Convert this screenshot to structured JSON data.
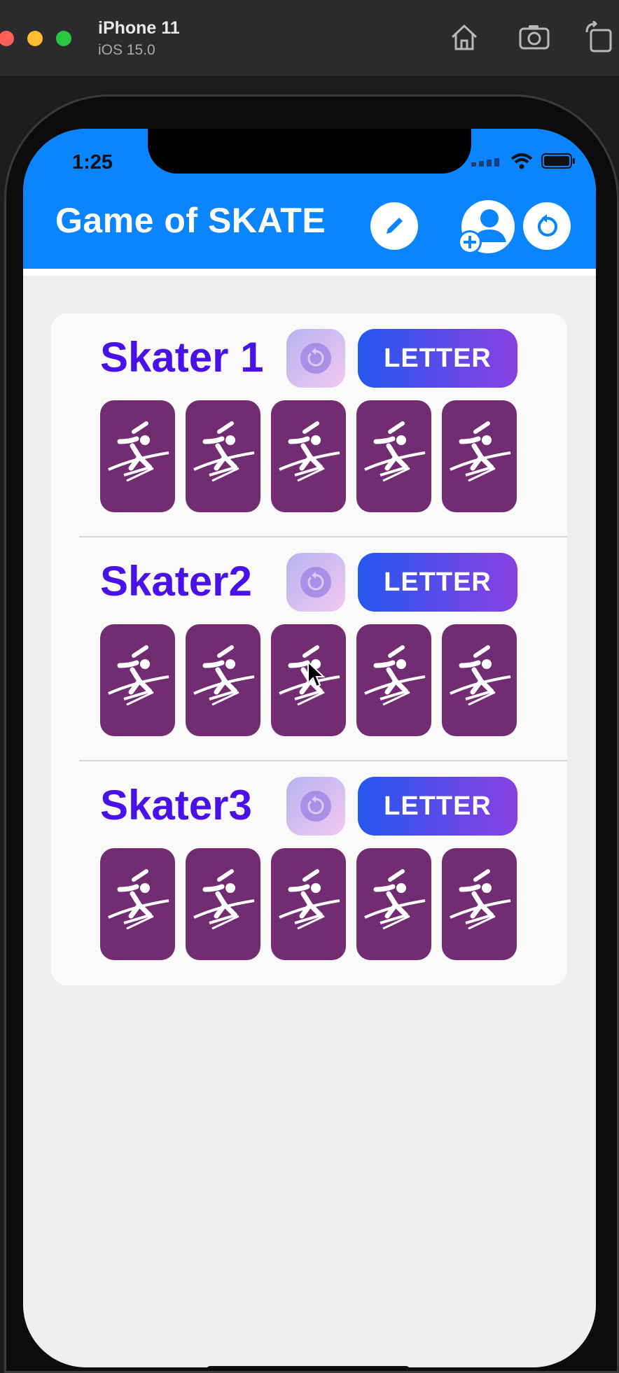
{
  "simulator": {
    "device_name": "iPhone 11",
    "os_version": "iOS 15.0",
    "toolbar_icons": [
      "home-icon",
      "screenshot-icon",
      "rotate-icon"
    ]
  },
  "status_bar": {
    "time": "1:25",
    "icons": [
      "signal-icon",
      "wifi-icon",
      "battery-icon"
    ]
  },
  "header": {
    "title": "Game of SKATE",
    "buttons": [
      "edit-icon",
      "add-player-icon",
      "reset-icon"
    ]
  },
  "skaters": [
    {
      "name": "Skater 1",
      "button_label": "LETTER",
      "tiles": 5
    },
    {
      "name": "Skater2",
      "button_label": "LETTER",
      "tiles": 5
    },
    {
      "name": "Skater3",
      "button_label": "LETTER",
      "tiles": 5
    }
  ],
  "colors": {
    "header_blue": "#0a84ff",
    "skater_name": "#4a12e8",
    "tile": "#722c72",
    "letter_gradient_start": "#2458f0",
    "letter_gradient_end": "#8b3fe0"
  }
}
